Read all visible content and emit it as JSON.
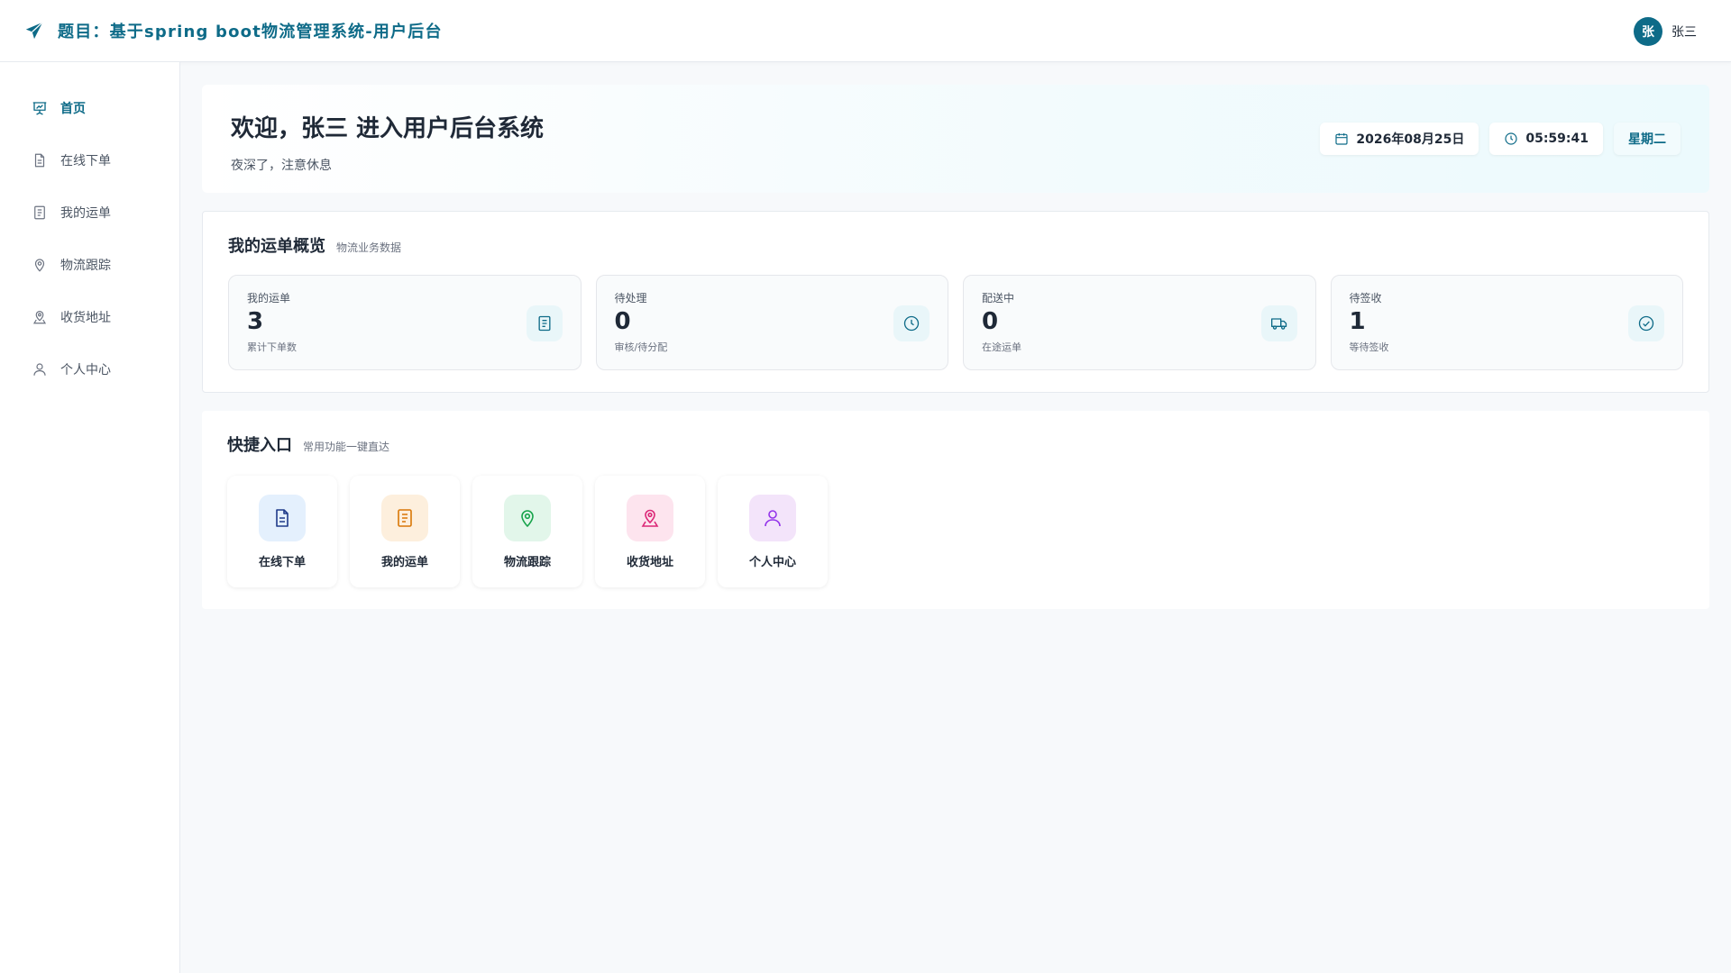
{
  "header": {
    "title": "题目：基于spring boot物流管理系统-用户后台",
    "user": {
      "avatar_text": "张",
      "name": "张三"
    },
    "icons": {
      "brand": "paper-plane-icon"
    }
  },
  "colors": {
    "brand": "#0e6b88",
    "blue": "#3b82f6",
    "orange": "#f59e0b",
    "green": "#22c55e",
    "pink": "#ec4899",
    "purple": "#a855f7"
  },
  "sidebar": {
    "items": [
      {
        "label": "首页",
        "icon": "presentation-chart-icon",
        "active": true
      },
      {
        "label": "在线下单",
        "icon": "document-icon",
        "active": false
      },
      {
        "label": "我的运单",
        "icon": "list-document-icon",
        "active": false
      },
      {
        "label": "物流跟踪",
        "icon": "location-pin-icon",
        "active": false
      },
      {
        "label": "收货地址",
        "icon": "map-pin-icon",
        "active": false
      },
      {
        "label": "个人中心",
        "icon": "user-icon",
        "active": false
      }
    ]
  },
  "welcome": {
    "title": "欢迎，张三 进入用户后台系统",
    "subtitle": "夜深了，注意休息",
    "date": "2026年08月25日",
    "time": "05:59:41",
    "weekday": "星期二"
  },
  "overview": {
    "title": "我的运单概览",
    "subtitle": "物流业务数据",
    "cards": [
      {
        "label": "我的运单",
        "value": "3",
        "desc": "累计下单数",
        "icon": "list-document-icon"
      },
      {
        "label": "待处理",
        "value": "0",
        "desc": "审核/待分配",
        "icon": "clock-icon"
      },
      {
        "label": "配送中",
        "value": "0",
        "desc": "在途运单",
        "icon": "truck-icon"
      },
      {
        "label": "待签收",
        "value": "1",
        "desc": "等待签收",
        "icon": "check-circle-icon"
      }
    ]
  },
  "quick": {
    "title": "快捷入口",
    "subtitle": "常用功能一键直达",
    "items": [
      {
        "label": "在线下单",
        "icon": "document-icon"
      },
      {
        "label": "我的运单",
        "icon": "list-document-icon"
      },
      {
        "label": "物流跟踪",
        "icon": "location-pin-icon"
      },
      {
        "label": "收货地址",
        "icon": "map-pin-icon"
      },
      {
        "label": "个人中心",
        "icon": "user-icon"
      }
    ]
  }
}
